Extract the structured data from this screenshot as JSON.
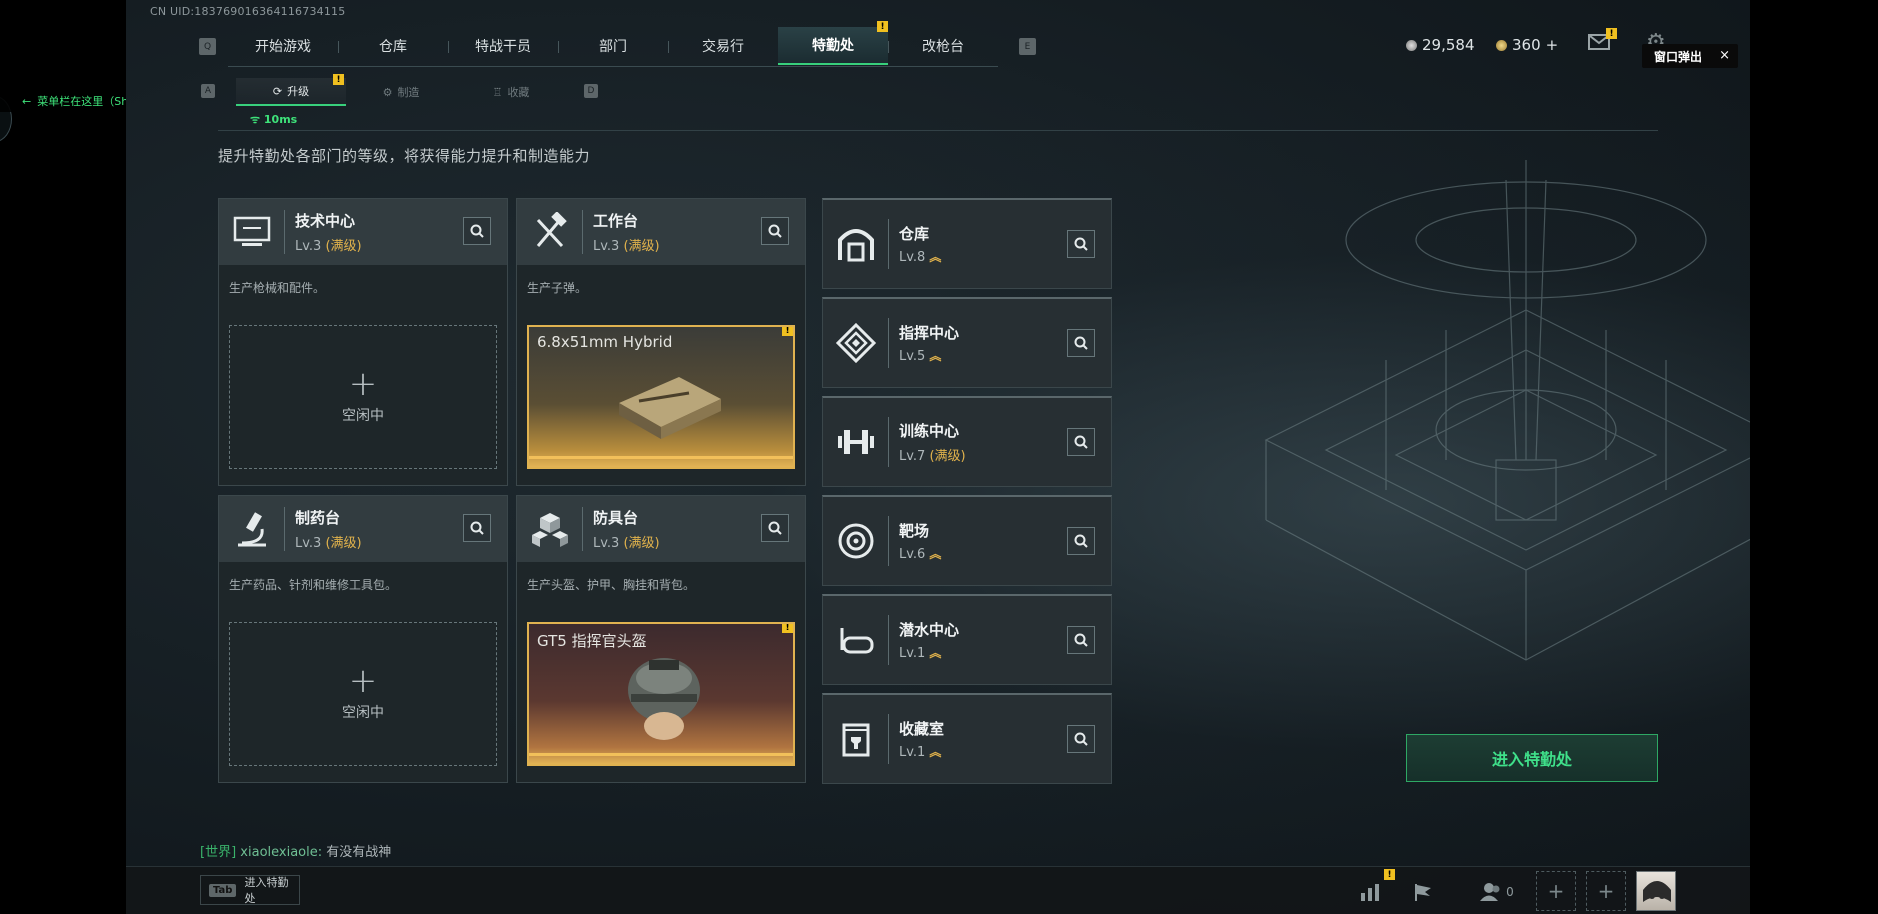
{
  "uid": "CN UID:18376901636411673411​5",
  "top_nav": {
    "left_key": "Q",
    "right_key": "E",
    "tabs": [
      "开始游戏",
      "仓库",
      "特战干员",
      "部门",
      "交易行",
      "特勤处",
      "改枪台"
    ],
    "active": "特勤处",
    "alert_mark": "!"
  },
  "sub_nav": {
    "left_key": "A",
    "right_key": "D",
    "tabs": [
      "升级",
      "制造",
      "收藏"
    ],
    "active": "升级"
  },
  "currency": {
    "silver": "29,584",
    "gold": "360",
    "gold_add": "+"
  },
  "popout": {
    "label": "窗口弹出",
    "close": "×"
  },
  "helper": {
    "text": "菜单栏在这里（Shift+Tab可快速唤起）",
    "ping": "10ms",
    "arrow": "←"
  },
  "description": "提升特勤处各部门的等级，将获得能力提升和制造能力",
  "cards": [
    {
      "title": "技术中心",
      "level": "Lv.3",
      "max": "(满级)",
      "desc": "生产枪械和配件。",
      "idle": "空闲中",
      "plus": "+",
      "icon": "computer-icon"
    },
    {
      "title": "工作台",
      "level": "Lv.3",
      "max": "(满级)",
      "desc": "生产子弹。",
      "product": "6.8x51mm Hybrid",
      "icon": "hammer-wrench-icon"
    },
    {
      "title": "制药台",
      "level": "Lv.3",
      "max": "(满级)",
      "desc": "生产药品、针剂和维修工具包。",
      "idle": "空闲中",
      "plus": "+",
      "icon": "microscope-icon"
    },
    {
      "title": "防具台",
      "level": "Lv.3",
      "max": "(满级)",
      "desc": "生产头盔、护甲、胸挂和背包。",
      "product": "GT5 指挥官头盔",
      "icon": "blocks-icon"
    }
  ],
  "departments": [
    {
      "title": "仓库",
      "level": "Lv.8",
      "upgrade": true,
      "icon": "garage-icon"
    },
    {
      "title": "指挥中心",
      "level": "Lv.5",
      "upgrade": true,
      "icon": "command-icon"
    },
    {
      "title": "训练中心",
      "level": "Lv.7",
      "max": "(满级)",
      "icon": "dumbbell-icon"
    },
    {
      "title": "靶场",
      "level": "Lv.6",
      "upgrade": true,
      "icon": "target-icon"
    },
    {
      "title": "潜水中心",
      "level": "Lv.1",
      "upgrade": true,
      "icon": "goggles-icon"
    },
    {
      "title": "收藏室",
      "level": "Lv.1",
      "upgrade": true,
      "icon": "trophy-case-icon"
    }
  ],
  "enter_button": "进入特勤处",
  "chat": {
    "channel": "[世界]",
    "user": "xiaolexiaole:",
    "message": "有没有战神"
  },
  "bottom": {
    "tab_key": "Tab",
    "tab_hint": "进入特勤处",
    "friends_count": "0",
    "plus": "+"
  },
  "colors": {
    "accent_green": "#38d07c",
    "gold": "#e2b34c",
    "alert_yellow": "#f0c020"
  }
}
